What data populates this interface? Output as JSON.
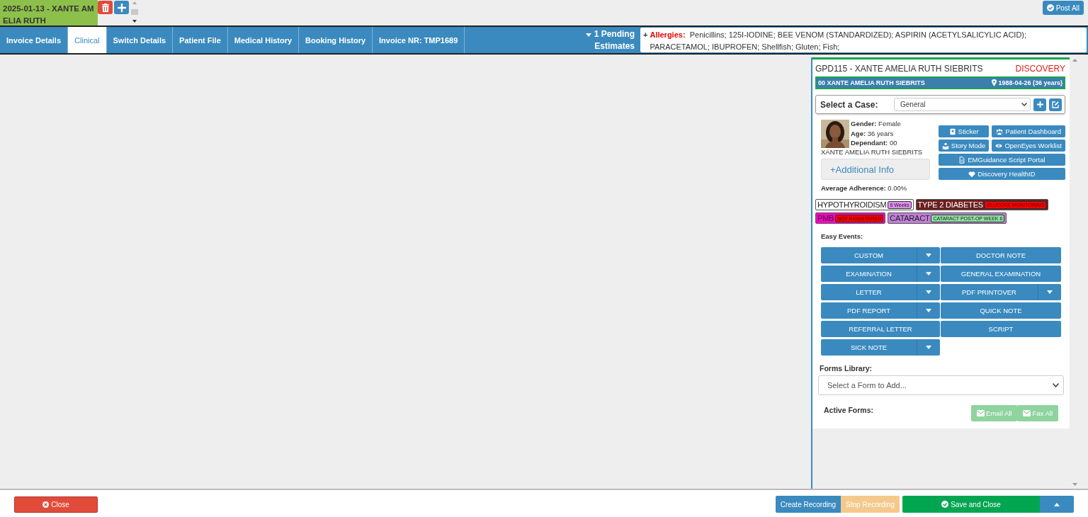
{
  "invoice_tab": {
    "label": "2025-01-13 - XANTE AMELIA RUTH"
  },
  "top_actions": {
    "post_all": "Post All"
  },
  "tabs": [
    {
      "label": "Invoice Details",
      "selected": false
    },
    {
      "label": "Clinical",
      "selected": true
    },
    {
      "label": "Switch Details",
      "selected": false
    },
    {
      "label": "Patient File",
      "selected": false
    },
    {
      "label": "Medical History",
      "selected": false
    },
    {
      "label": "Booking History",
      "selected": false
    },
    {
      "label": "Invoice NR: TMP1689",
      "selected": false
    }
  ],
  "pending": {
    "label": "1 Pending Estimates"
  },
  "allergies": {
    "expand": "+",
    "label": "Allergies:",
    "text": "Penicillins; 125I-IODINE; BEE VENOM (STANDARDIZED); ASPIRIN (ACETYLSALICYLIC ACID); PARACETAMOL; IBUPROFEN; Shellfish; Gluten; Fish;"
  },
  "patient": {
    "title": "GPD115 - XANTE AMELIA RUTH SIEBRITS",
    "scheme": "DISCOVERY",
    "banner_name": "00 XANTE AMELIA RUTH SIEBRITS",
    "banner_dob": "1988-04-26 (36 years)",
    "case_label": "Select a Case:",
    "case_value": "General",
    "details": [
      {
        "label": "Gender:",
        "value": "Female"
      },
      {
        "label": "Age:",
        "value": "36 years"
      },
      {
        "label": "Dependant:",
        "value": "00"
      }
    ],
    "full_name": "XANTE AMELIA RUTH SIEBRITS",
    "additional_info": "+Additional Info",
    "adherence_label": "Average Adherence:",
    "adherence_value": "0.00%"
  },
  "actions": [
    {
      "label": "Sticker"
    },
    {
      "label": "Patient Dashboard"
    },
    {
      "label": "Story Mode"
    },
    {
      "label": "OpenEyes Worklist"
    },
    {
      "label": "EMGuidance Script Portal"
    },
    {
      "label": "Discovery HealthID"
    }
  ],
  "conditions": [
    {
      "name": "HYPOTHYROIDISM",
      "color": "#ffffff",
      "tag": {
        "label": "6 Weeks",
        "color": "#e08ff0"
      }
    },
    {
      "name": "TYPE 2 DIABETES",
      "color": "#6b1f1f",
      "tag": {
        "label": "GLUCOSE MONITORING",
        "color": "#ff0000"
      }
    },
    {
      "name": "PMB",
      "color": "#ff00c8",
      "tag": {
        "label": "NOT REGISTERED",
        "color": "#ff0000"
      }
    },
    {
      "name": "CATARACT",
      "color": "#c080d8",
      "tag": {
        "label": "CATARACT POST-OP WEEK 6",
        "color": "#8ee0a0"
      }
    }
  ],
  "easy_events": {
    "label": "Easy Events:",
    "items": [
      {
        "label": "CUSTOM",
        "dropdown": true
      },
      {
        "label": "DOCTOR NOTE",
        "dropdown": false
      },
      {
        "label": "EXAMINATION",
        "dropdown": true
      },
      {
        "label": "GENERAL EXAMINATION",
        "dropdown": false
      },
      {
        "label": "LETTER",
        "dropdown": true
      },
      {
        "label": "PDF PRINTOVER",
        "dropdown": true
      },
      {
        "label": "PDF REPORT",
        "dropdown": true
      },
      {
        "label": "QUICK NOTE",
        "dropdown": false
      },
      {
        "label": "REFERRAL LETTER",
        "dropdown": false
      },
      {
        "label": "SCRIPT",
        "dropdown": false
      },
      {
        "label": "SICK NOTE",
        "dropdown": true
      }
    ]
  },
  "forms": {
    "label": "Forms Library:",
    "placeholder": "Select a Form to Add...",
    "active_label": "Active Forms:",
    "email_all": {
      "label": "Email All",
      "disabled": true
    },
    "fax_all": {
      "label": "Fax All",
      "disabled": true
    }
  },
  "footer": {
    "close": "Close",
    "create_recording": {
      "label": "Create Recording",
      "disabled": false
    },
    "stop_recording": {
      "label": "Stop Recording",
      "disabled": true
    },
    "save_close": "Save and Close"
  }
}
